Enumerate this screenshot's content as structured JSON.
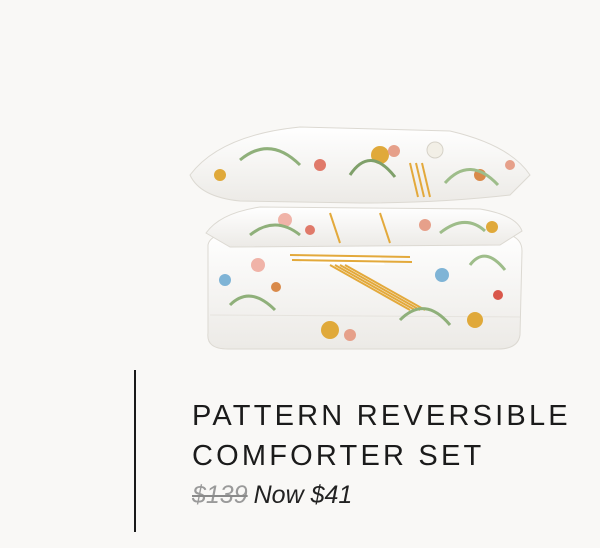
{
  "product": {
    "title_line1": "PATTERN REVERSIBLE",
    "title_line2": "COMFORTER SET",
    "old_price": "$139",
    "new_price": "Now $41"
  },
  "image": {
    "icon": "floral-comforter-set-image"
  },
  "colors": {
    "background": "#f9f8f6",
    "text": "#1b1b1b",
    "old_price": "#9a9a9a",
    "stripe": "#e3a93b"
  }
}
